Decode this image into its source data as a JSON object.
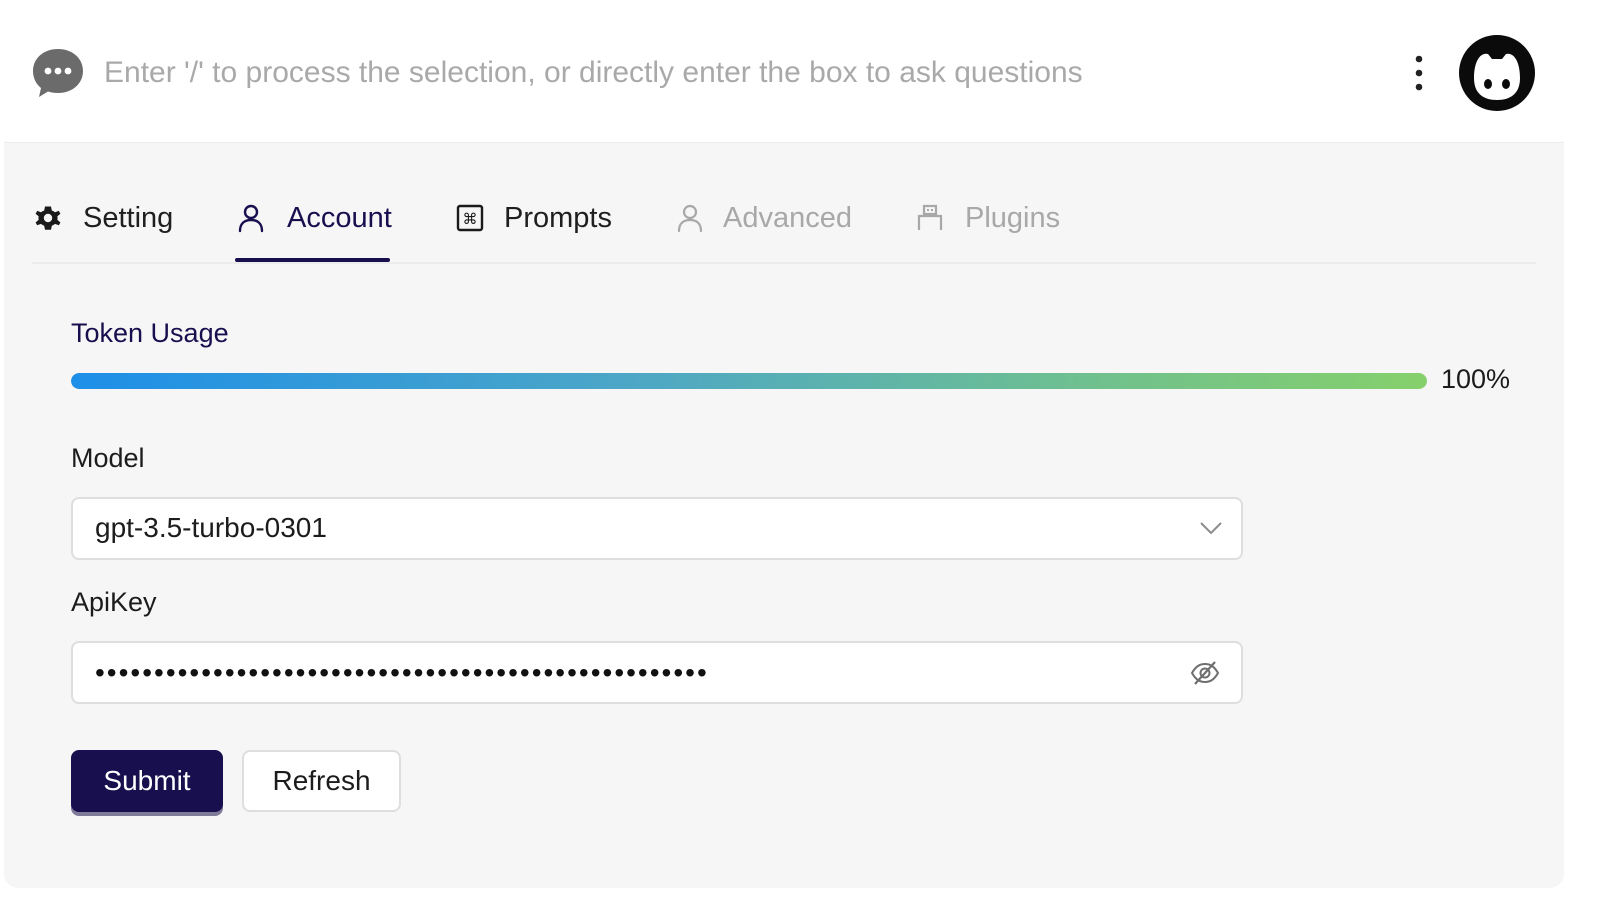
{
  "header": {
    "search_placeholder": "Enter '/' to process the selection, or directly enter the box to ask questions",
    "icons": {
      "chat": "chat-bubble-icon",
      "more": "more-vertical-icon",
      "avatar": "cat-avatar-icon"
    }
  },
  "tabs": [
    {
      "label": "Setting",
      "icon": "gear-icon",
      "state": "normal"
    },
    {
      "label": "Account",
      "icon": "user-icon",
      "state": "active"
    },
    {
      "label": "Prompts",
      "icon": "command-icon",
      "state": "normal"
    },
    {
      "label": "Advanced",
      "icon": "user-icon",
      "state": "disabled"
    },
    {
      "label": "Plugins",
      "icon": "plugin-icon",
      "state": "disabled"
    }
  ],
  "account": {
    "token_usage_label": "Token Usage",
    "token_usage_percent": 100,
    "token_usage_text": "100%",
    "model_label": "Model",
    "model_value": "gpt-3.5-turbo-0301",
    "apikey_label": "ApiKey",
    "apikey_masked": "••••••••••••••••••••••••••••••••••••••••••••••••••••",
    "submit_label": "Submit",
    "refresh_label": "Refresh"
  },
  "colors": {
    "accent": "#180f4f",
    "progress_start": "#1d8fe8",
    "progress_end": "#86d06b",
    "disabled_text": "#a8a8a8",
    "background": "#f6f6f6"
  }
}
